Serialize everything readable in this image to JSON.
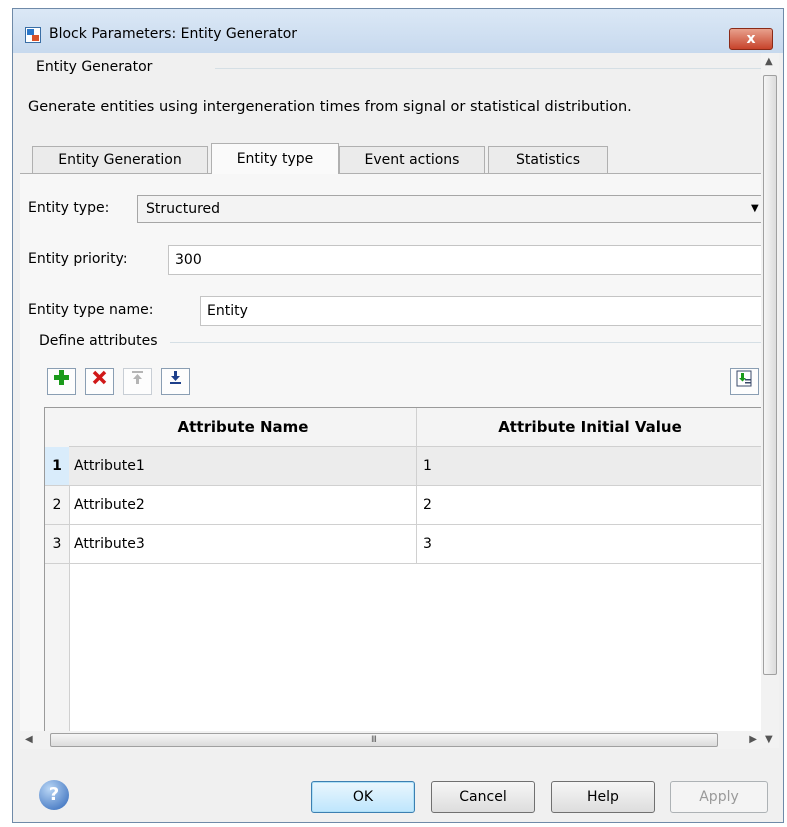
{
  "window": {
    "title": "Block Parameters: Entity Generator",
    "close_label": "x"
  },
  "block": {
    "group_title": "Entity Generator",
    "description": "Generate entities using intergeneration times from signal or statistical distribution."
  },
  "tabs": [
    {
      "label": "Entity Generation",
      "active": false
    },
    {
      "label": "Entity type",
      "active": true
    },
    {
      "label": "Event actions",
      "active": false
    },
    {
      "label": "Statistics",
      "active": false
    }
  ],
  "form": {
    "entity_type_label": "Entity type:",
    "entity_type_value": "Structured",
    "priority_label": "Entity priority:",
    "priority_value": "300",
    "type_name_label": "Entity type name:",
    "type_name_value": "Entity",
    "attributes_group": "Define attributes"
  },
  "attributes_table": {
    "headers": [
      "Attribute Name",
      "Attribute Initial Value"
    ],
    "rows": [
      {
        "num": "1",
        "name": "Attribute1",
        "value": "1"
      },
      {
        "num": "2",
        "name": "Attribute2",
        "value": "2"
      },
      {
        "num": "3",
        "name": "Attribute3",
        "value": "3"
      }
    ],
    "selected_row": 1
  },
  "toolbar_icons": [
    "add-icon",
    "delete-icon",
    "move-up-icon",
    "move-down-icon",
    "import-icon"
  ],
  "scroll": {
    "grip": "III"
  },
  "buttons": {
    "ok": "OK",
    "cancel": "Cancel",
    "help": "Help",
    "apply": "Apply"
  },
  "colors": {
    "add": "#1a9a1a",
    "delete": "#d01818",
    "close_button": "#c7432b"
  }
}
